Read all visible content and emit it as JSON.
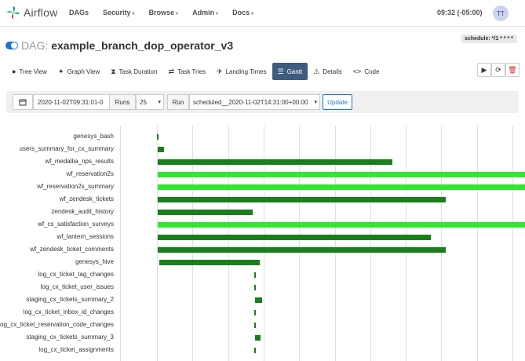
{
  "navbar": {
    "logo_text": "Airflow",
    "items": [
      {
        "label": "DAGs",
        "dropdown": false
      },
      {
        "label": "Security",
        "dropdown": true
      },
      {
        "label": "Browse",
        "dropdown": true
      },
      {
        "label": "Admin",
        "dropdown": true
      },
      {
        "label": "Docs",
        "dropdown": true
      }
    ],
    "clock": "09:32 (-05:00)",
    "avatar": "TT"
  },
  "dag": {
    "label": "DAG:",
    "name": "example_branch_dop_operator_v3",
    "schedule": "schedule: */1 * * * *"
  },
  "tabs": [
    {
      "label": "Tree View",
      "icon": "tree-icon",
      "glyph": "●"
    },
    {
      "label": "Graph View",
      "icon": "graph-icon",
      "glyph": "✦"
    },
    {
      "label": "Task Duration",
      "icon": "hourglass-icon",
      "glyph": "⧗"
    },
    {
      "label": "Task Tries",
      "icon": "retry-icon",
      "glyph": "⇄"
    },
    {
      "label": "Landing Times",
      "icon": "landing-icon",
      "glyph": "✈"
    },
    {
      "label": "Gantt",
      "icon": "gantt-icon",
      "glyph": "☰",
      "active": true
    },
    {
      "label": "Details",
      "icon": "warning-icon",
      "glyph": "⚠"
    },
    {
      "label": "Code",
      "icon": "code-icon",
      "glyph": "<>"
    }
  ],
  "filters": {
    "date": "2020-11-02T09:31:01-0",
    "runs_label": "Runs",
    "runs_value": "25",
    "run_label": "Run",
    "run_value": "scheduled__2020-11-02T14:31:00+00:00",
    "update_label": "Update"
  },
  "colors": {
    "success": "#1a7f1a",
    "running": "#32e632",
    "accent": "#3e5c80"
  },
  "gantt": {
    "tasks": [
      {
        "name": "genesys_bash",
        "start": 0.0,
        "end": 0.4,
        "state": "success"
      },
      {
        "name": "users_summary_for_cx_summary",
        "start": 0.3,
        "end": 2.0,
        "state": "success"
      },
      {
        "name": "wf_medallia_nps_results",
        "start": 0.3,
        "end": 64.0,
        "state": "success"
      },
      {
        "name": "wf_reservation2s",
        "start": 0.3,
        "end": 100,
        "state": "running"
      },
      {
        "name": "wf_reservation2s_summary",
        "start": 0.3,
        "end": 100,
        "state": "running"
      },
      {
        "name": "wf_zendesk_tickets",
        "start": 0.3,
        "end": 78.5,
        "state": "success"
      },
      {
        "name": "zendesk_audit_history",
        "start": 0.3,
        "end": 26.0,
        "state": "success"
      },
      {
        "name": "wf_cs_satisfaction_surveys",
        "start": 0.3,
        "end": 100,
        "state": "running"
      },
      {
        "name": "wf_lantern_sessions",
        "start": 0.3,
        "end": 74.5,
        "state": "success"
      },
      {
        "name": "wf_zendesk_ticket_comments",
        "start": 0.3,
        "end": 78.5,
        "state": "success"
      },
      {
        "name": "genesys_hive",
        "start": 0.6,
        "end": 28.0,
        "state": "success"
      },
      {
        "name": "log_cx_ticket_tag_changes",
        "start": 26.4,
        "end": 26.9,
        "state": "success"
      },
      {
        "name": "log_cx_ticket_user_issues",
        "start": 26.4,
        "end": 26.9,
        "state": "success"
      },
      {
        "name": "staging_cx_tickets_summary_2",
        "start": 26.6,
        "end": 28.6,
        "state": "success"
      },
      {
        "name": "log_cx_ticket_inbox_id_changes",
        "start": 26.4,
        "end": 26.9,
        "state": "success"
      },
      {
        "name": "log_cx_ticket_reservation_code_changes",
        "start": 26.4,
        "end": 26.9,
        "state": "success"
      },
      {
        "name": "staging_cx_tickets_summary_3",
        "start": 26.6,
        "end": 28.2,
        "state": "success"
      },
      {
        "name": "log_cx_ticket_assignments",
        "start": 26.4,
        "end": 26.9,
        "state": "success"
      }
    ]
  }
}
